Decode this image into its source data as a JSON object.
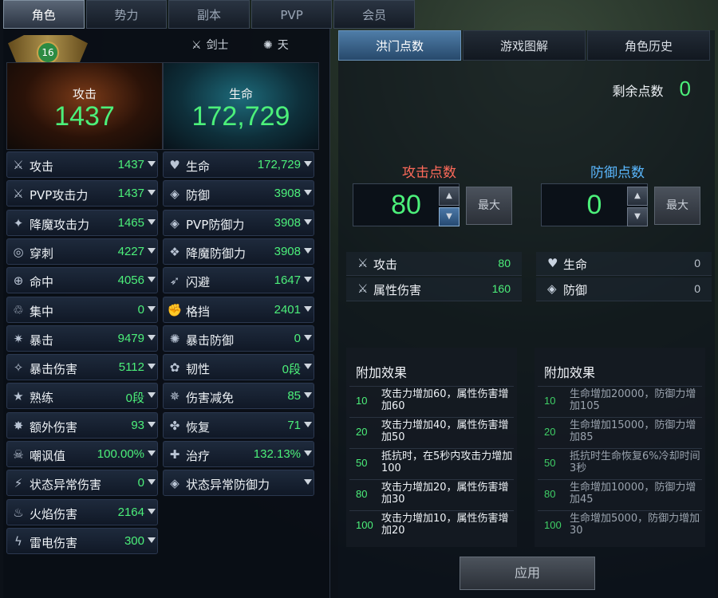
{
  "tabs": [
    "角色",
    "势力",
    "副本",
    "PVP",
    "会员"
  ],
  "level": "16",
  "class_name": "剑士",
  "server": "天",
  "hero": {
    "attack_label": "攻击",
    "attack_value": "1437",
    "hp_label": "生命",
    "hp_value": "172,729"
  },
  "left_stats": [
    {
      "icon": "⚔",
      "name": "攻击",
      "value": "1437"
    },
    {
      "icon": "⚔",
      "name": "PVP攻击力",
      "value": "1437"
    },
    {
      "icon": "✦",
      "name": "降魔攻击力",
      "value": "1465"
    },
    {
      "icon": "◎",
      "name": "穿刺",
      "value": "4227"
    },
    {
      "icon": "⊕",
      "name": "命中",
      "value": "4056"
    },
    {
      "icon": "♲",
      "name": "集中",
      "value": "0"
    },
    {
      "icon": "✷",
      "name": "暴击",
      "value": "9479"
    },
    {
      "icon": "✧",
      "name": "暴击伤害",
      "value": "5112"
    },
    {
      "icon": "★",
      "name": "熟练",
      "value": "0段"
    },
    {
      "icon": "✸",
      "name": "额外伤害",
      "value": "93"
    },
    {
      "icon": "☠",
      "name": "嘲讽值",
      "value": "100.00%"
    },
    {
      "icon": "⚡",
      "name": "状态异常伤害",
      "value": "0"
    },
    {
      "icon": "♨",
      "name": "火焰伤害",
      "value": "2164"
    },
    {
      "icon": "ϟ",
      "name": "雷电伤害",
      "value": "300"
    }
  ],
  "right_stats": [
    {
      "icon": "♥",
      "name": "生命",
      "value": "172,729"
    },
    {
      "icon": "◈",
      "name": "防御",
      "value": "3908"
    },
    {
      "icon": "◈",
      "name": "PVP防御力",
      "value": "3908"
    },
    {
      "icon": "❖",
      "name": "降魔防御力",
      "value": "3908"
    },
    {
      "icon": "➶",
      "name": "闪避",
      "value": "1647"
    },
    {
      "icon": "✊",
      "name": "格挡",
      "value": "2401"
    },
    {
      "icon": "✺",
      "name": "暴击防御",
      "value": "0"
    },
    {
      "icon": "✿",
      "name": "韧性",
      "value": "0段"
    },
    {
      "icon": "✵",
      "name": "伤害减免",
      "value": "85"
    },
    {
      "icon": "✤",
      "name": "恢复",
      "value": "71"
    },
    {
      "icon": "✚",
      "name": "治疗",
      "value": "132.13%"
    },
    {
      "icon": "◈",
      "name": "状态异常防御力",
      "value": ""
    }
  ],
  "right_tabs": [
    "洪门点数",
    "游戏图解",
    "角色历史"
  ],
  "remaining_label": "剩余点数",
  "remaining_value": "0",
  "attack_points": {
    "title": "攻击点数",
    "value": "80",
    "max_label": "最大",
    "title_color": "#ff6a5a"
  },
  "defense_points": {
    "title": "防御点数",
    "value": "0",
    "max_label": "最大",
    "title_color": "#5ab8ff"
  },
  "attack_bonus": [
    {
      "icon": "⚔",
      "name": "攻击",
      "value": "80"
    },
    {
      "icon": "⚔",
      "name": "属性伤害",
      "value": "160"
    }
  ],
  "defense_bonus": [
    {
      "icon": "♥",
      "name": "生命",
      "value": "0"
    },
    {
      "icon": "◈",
      "name": "防御",
      "value": "0"
    }
  ],
  "attack_effects": {
    "title": "附加效果",
    "rows": [
      {
        "k": "10",
        "t": "攻击力增加60，属性伤害增加60"
      },
      {
        "k": "20",
        "t": "攻击力增加40，属性伤害增加50"
      },
      {
        "k": "50",
        "t": "抵抗时，在5秒内攻击力增加100"
      },
      {
        "k": "80",
        "t": "攻击力增加20，属性伤害增加30"
      },
      {
        "k": "100",
        "t": "攻击力增加10，属性伤害增加20"
      }
    ]
  },
  "defense_effects": {
    "title": "附加效果",
    "rows": [
      {
        "k": "10",
        "t": "生命增加20000，防御力增加105"
      },
      {
        "k": "20",
        "t": "生命增加15000，防御力增加85"
      },
      {
        "k": "50",
        "t": "抵抗时生命恢复6%冷却时间3秒"
      },
      {
        "k": "80",
        "t": "生命增加10000，防御力增加45"
      },
      {
        "k": "100",
        "t": "生命增加5000，防御力增加30"
      }
    ]
  },
  "apply_label": "应用"
}
